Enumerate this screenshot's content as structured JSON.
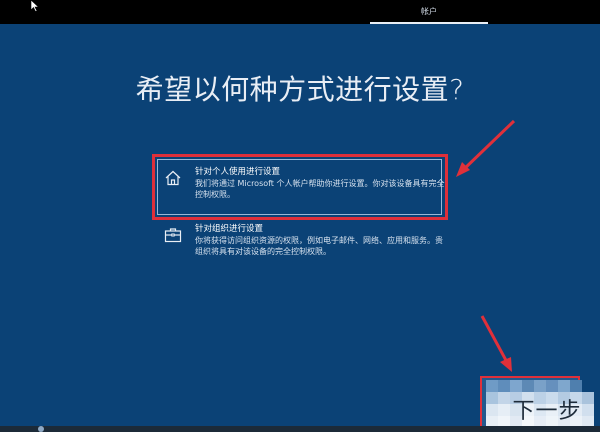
{
  "header": {
    "tab_label": "帐户"
  },
  "main": {
    "title": "希望以何种方式进行设置?",
    "options": [
      {
        "icon": "home-icon",
        "title": "针对个人使用进行设置",
        "description": "我们将通过 Microsoft 个人帐户帮助你进行设置。你对该设备具有完全控制权限。"
      },
      {
        "icon": "briefcase-icon",
        "title": "针对组织进行设置",
        "description": "你将获得访问组织资源的权限，例如电子邮件、网络、应用和服务。贵组织将具有对该设备的完全控制权限。"
      }
    ]
  },
  "footer": {
    "next_label": "下一步"
  },
  "colors": {
    "background": "#0b4276",
    "annotation_red": "#e0303a",
    "text": "#e9eef5"
  }
}
